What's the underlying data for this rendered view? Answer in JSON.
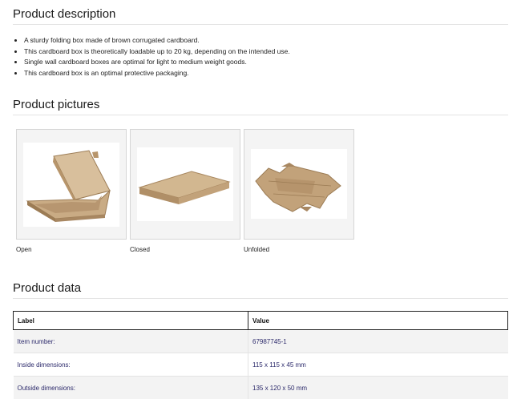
{
  "description": {
    "title": "Product description",
    "bullets": [
      "A sturdy folding box made of brown corrugated cardboard.",
      "This cardboard box is theoretically loadable up to 20 kg, depending on the intended use.",
      "Single wall cardboard boxes are optimal for light to medium weight goods.",
      "This cardboard box is an optimal protective packaging."
    ]
  },
  "pictures": {
    "title": "Product pictures",
    "items": [
      {
        "label": "Open"
      },
      {
        "label": "Closed"
      },
      {
        "label": "Unfolded"
      }
    ]
  },
  "product_data": {
    "title": "Product data",
    "columns": [
      "Label",
      "Value"
    ],
    "rows": [
      {
        "label": "Item number:",
        "value": "67987745-1"
      },
      {
        "label": "Inside dimensions:",
        "value": "115 x 115 x 45 mm"
      },
      {
        "label": "Outside dimensions:",
        "value": "135 x 120 x 50 mm"
      }
    ]
  },
  "colors": {
    "cardboard": "#c2a27a",
    "cardboard_dark": "#9c7c55",
    "cardboard_light": "#d8bf9c",
    "table_value_text": "#2c2a6b"
  }
}
